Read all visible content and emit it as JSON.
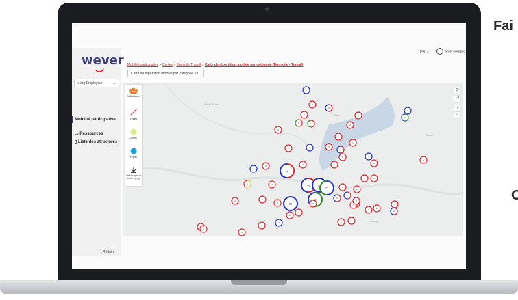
{
  "side_text": {
    "line1": "Fai",
    "line2": "C"
  },
  "app": {
    "logo": "wever",
    "profile_label": "tag Employeur",
    "lang": "FR",
    "account": "Mon compte",
    "reduce": "‹ Réduire"
  },
  "sidebar": {
    "items": [
      {
        "label": "Mobilité participative"
      },
      {
        "label": "Ressources"
      },
      {
        "label": "Liste des structures"
      }
    ]
  },
  "breadcrumb": {
    "part1": "Mobilité participative",
    "sep": " > ",
    "part2": "Cartes",
    "part3": "Domicile-Travail",
    "current": "Carte de répartition modale par catégorie (Domicile - Travail)"
  },
  "map_select": "Carte de répartition modale par catégorie (D...",
  "tools": [
    {
      "label": "Utilisateurs",
      "icon": "users-icon"
    },
    {
      "label": "Lignes",
      "icon": "line-icon"
    },
    {
      "label": "Zones",
      "icon": "zone-icon"
    },
    {
      "label": "Points",
      "icon": "point-icon"
    },
    {
      "label": "Télécharger la carte (.png)",
      "icon": "download-icon"
    }
  ],
  "map_controls": [
    "⊘",
    "⤢",
    "+",
    "−"
  ],
  "places": [
    "Saint-Claude",
    "Nyon",
    "Thonon",
    "Annecy"
  ],
  "colors": {
    "red": "#e3242b",
    "blue": "#2230c8",
    "green": "#2e8b2e",
    "yellow": "#e8d41e",
    "brand": "#3d3f7a"
  },
  "markers": [
    {
      "c": [
        "#2230c8"
      ],
      "n": "1"
    },
    {
      "c": [
        "#e3242b"
      ],
      "n": "3"
    },
    {
      "c": [
        "#e3242b",
        "#2230c8"
      ],
      "n": "1"
    },
    {
      "c": [
        "#e3242b"
      ],
      "n": "2"
    },
    {
      "c": [
        "#e3242b",
        "#2e8b2e"
      ],
      "n": "2"
    },
    {
      "c": [
        "#e3242b",
        "#2e8b2e"
      ],
      "n": "1"
    },
    {
      "c": [
        "#e3242b"
      ],
      "n": "1"
    },
    {
      "c": [
        "#e3242b"
      ],
      "n": "2"
    },
    {
      "c": [
        "#2230c8"
      ],
      "n": "3"
    },
    {
      "c": [
        "#2e8b2e",
        "#2230c8"
      ],
      "n": "2"
    },
    {
      "c": [
        "#e3242b"
      ],
      "n": "1"
    },
    {
      "c": [
        "#e3242b"
      ],
      "n": "3"
    },
    {
      "c": [
        "#e3242b"
      ],
      "n": "1"
    },
    {
      "c": [
        "#e3242b"
      ],
      "n": "1"
    },
    {
      "c": [
        "#e3242b"
      ],
      "n": "2"
    },
    {
      "c": [
        "#2230c8"
      ],
      "n": "3"
    },
    {
      "c": [
        "#e3242b",
        "#2230c8"
      ],
      "n": "2"
    },
    {
      "c": [
        "#e3242b"
      ],
      "n": "3"
    },
    {
      "c": [
        "#2230c8"
      ],
      "n": "1"
    },
    {
      "c": [
        "#e3242b"
      ],
      "n": "2"
    },
    {
      "c": [
        "#e3242b"
      ],
      "n": "1"
    },
    {
      "c": [
        "#e3242b"
      ],
      "n": "1"
    },
    {
      "c": [
        "#e3242b"
      ],
      "n": "2"
    },
    {
      "c": [
        "#e3242b",
        "#2230c8"
      ],
      "n": "14"
    },
    {
      "c": [
        "#2230c8"
      ],
      "n": "2"
    },
    {
      "c": [
        "#e3242b"
      ],
      "n": "3"
    },
    {
      "c": [
        "#e3242b"
      ],
      "n": "2"
    },
    {
      "c": [
        "#e8d41e",
        "#e3242b"
      ],
      "n": "1"
    },
    {
      "c": [
        "#e3242b"
      ],
      "n": "2"
    },
    {
      "c": [
        "#e3242b",
        "#2230c8"
      ],
      "n": "40"
    },
    {
      "c": [
        "#2230c8"
      ],
      "n": "63"
    },
    {
      "c": [
        "#2230c8",
        "#2e8b2e"
      ],
      "n": "21"
    },
    {
      "c": [
        "#e3242b"
      ],
      "n": "1"
    },
    {
      "c": [
        "#e3242b"
      ],
      "n": "2"
    },
    {
      "c": [
        "#e3242b",
        "#2230c8"
      ],
      "n": "2"
    },
    {
      "c": [
        "#e3242b"
      ],
      "n": "2"
    },
    {
      "c": [
        "#e3242b"
      ],
      "n": "3"
    },
    {
      "c": [
        "#e3242b",
        "#2230c8"
      ],
      "n": "2"
    },
    {
      "c": [
        "#2e8b2e",
        "#2230c8"
      ],
      "n": "11"
    },
    {
      "c": [
        "#2230c8"
      ],
      "n": "25"
    },
    {
      "c": [
        "#e3242b"
      ],
      "n": "10"
    },
    {
      "c": [
        "#e3242b"
      ],
      "n": "1"
    },
    {
      "c": [
        "#e3242b"
      ],
      "n": "2"
    },
    {
      "c": [
        "#e3242b"
      ],
      "n": "3"
    },
    {
      "c": [
        "#e3242b"
      ],
      "n": "1"
    },
    {
      "c": [
        "#e3242b"
      ],
      "n": "2"
    },
    {
      "c": [
        "#e3242b"
      ],
      "n": "2"
    },
    {
      "c": [
        "#e3242b"
      ],
      "n": "1"
    },
    {
      "c": [
        "#e3242b"
      ],
      "n": "2"
    },
    {
      "c": [
        "#e3242b",
        "#2230c8"
      ],
      "n": "2"
    },
    {
      "c": [
        "#2230c8"
      ],
      "n": "2"
    },
    {
      "c": [
        "#e3242b"
      ],
      "n": "2"
    },
    {
      "c": [
        "#e3242b"
      ],
      "n": "3"
    },
    {
      "c": [
        "#e3242b"
      ],
      "n": "2"
    },
    {
      "c": [
        "#e3242b"
      ],
      "n": "1"
    },
    {
      "c": [
        "#e3242b"
      ],
      "n": "1"
    },
    {
      "c": [
        "#e3242b"
      ],
      "n": "1"
    },
    {
      "c": [
        "#e3242b"
      ],
      "n": "3"
    },
    {
      "c": [
        "#e3242b"
      ],
      "n": "1"
    }
  ]
}
